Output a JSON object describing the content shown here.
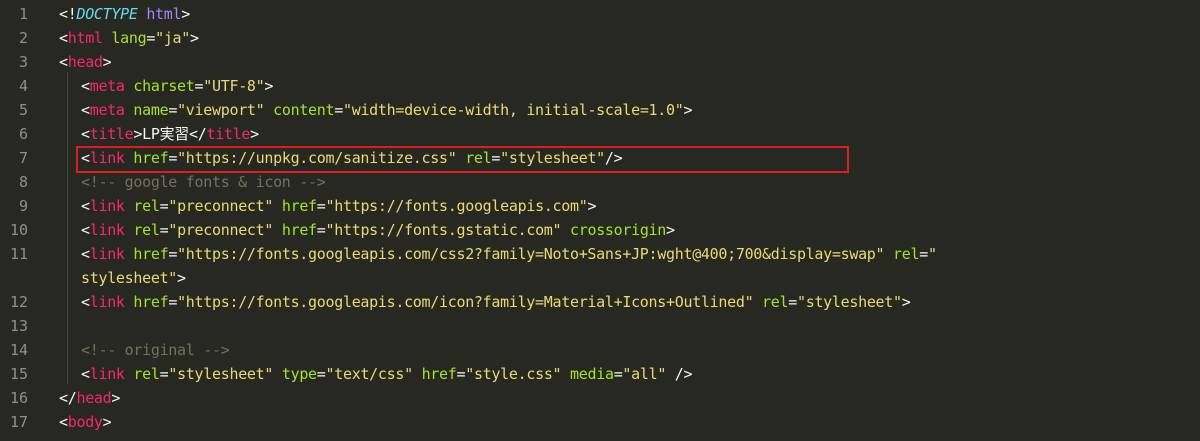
{
  "editor": {
    "theme": "dark",
    "colors": {
      "background": "#272822",
      "tag": "#f92672",
      "attribute": "#a6e22e",
      "string": "#e6db74",
      "comment": "#75715e",
      "line_number": "#90908a",
      "highlight_border": "#d9201f"
    },
    "lines": [
      {
        "n": "1",
        "indent": 0,
        "tokens": [
          {
            "t": "punct",
            "v": "<!"
          },
          {
            "t": "doc",
            "v": "DOCTYPE"
          },
          {
            "t": "punct",
            "v": " "
          },
          {
            "t": "doctype",
            "v": "html"
          },
          {
            "t": "punct",
            "v": ">"
          }
        ]
      },
      {
        "n": "2",
        "indent": 0,
        "tokens": [
          {
            "t": "punct",
            "v": "<"
          },
          {
            "t": "tag",
            "v": "html"
          },
          {
            "t": "punct",
            "v": " "
          },
          {
            "t": "attr",
            "v": "lang"
          },
          {
            "t": "punct",
            "v": "="
          },
          {
            "t": "str",
            "v": "\"ja\""
          },
          {
            "t": "punct",
            "v": ">"
          }
        ]
      },
      {
        "n": "3",
        "indent": 0,
        "tokens": [
          {
            "t": "punct",
            "v": "<"
          },
          {
            "t": "tag",
            "v": "head"
          },
          {
            "t": "punct",
            "v": ">"
          }
        ]
      },
      {
        "n": "4",
        "indent": 1,
        "tokens": [
          {
            "t": "punct",
            "v": "<"
          },
          {
            "t": "tag",
            "v": "meta"
          },
          {
            "t": "punct",
            "v": " "
          },
          {
            "t": "attr",
            "v": "charset"
          },
          {
            "t": "punct",
            "v": "="
          },
          {
            "t": "str",
            "v": "\"UTF-8\""
          },
          {
            "t": "punct",
            "v": ">"
          }
        ]
      },
      {
        "n": "5",
        "indent": 1,
        "tokens": [
          {
            "t": "punct",
            "v": "<"
          },
          {
            "t": "tag",
            "v": "meta"
          },
          {
            "t": "punct",
            "v": " "
          },
          {
            "t": "attr",
            "v": "name"
          },
          {
            "t": "punct",
            "v": "="
          },
          {
            "t": "str",
            "v": "\"viewport\""
          },
          {
            "t": "punct",
            "v": " "
          },
          {
            "t": "attr",
            "v": "content"
          },
          {
            "t": "punct",
            "v": "="
          },
          {
            "t": "str",
            "v": "\"width=device-width, initial-scale=1.0\""
          },
          {
            "t": "punct",
            "v": ">"
          }
        ]
      },
      {
        "n": "6",
        "indent": 1,
        "tokens": [
          {
            "t": "punct",
            "v": "<"
          },
          {
            "t": "tag",
            "v": "title"
          },
          {
            "t": "punct",
            "v": ">"
          },
          {
            "t": "text",
            "v": "LP実習"
          },
          {
            "t": "punct",
            "v": "</"
          },
          {
            "t": "tag",
            "v": "title"
          },
          {
            "t": "punct",
            "v": ">"
          }
        ]
      },
      {
        "n": "7",
        "indent": 1,
        "highlight": true,
        "tokens": [
          {
            "t": "punct",
            "v": "<"
          },
          {
            "t": "tag",
            "v": "link"
          },
          {
            "t": "punct",
            "v": " "
          },
          {
            "t": "attr",
            "v": "href"
          },
          {
            "t": "punct",
            "v": "="
          },
          {
            "t": "str",
            "v": "\"https://unpkg.com/sanitize.css\""
          },
          {
            "t": "punct",
            "v": " "
          },
          {
            "t": "attr",
            "v": "rel"
          },
          {
            "t": "punct",
            "v": "="
          },
          {
            "t": "str",
            "v": "\"stylesheet\""
          },
          {
            "t": "punct",
            "v": "/>"
          }
        ]
      },
      {
        "n": "8",
        "indent": 1,
        "tokens": [
          {
            "t": "comment",
            "v": "<!-- google fonts & icon -->"
          }
        ]
      },
      {
        "n": "9",
        "indent": 1,
        "tokens": [
          {
            "t": "punct",
            "v": "<"
          },
          {
            "t": "tag",
            "v": "link"
          },
          {
            "t": "punct",
            "v": " "
          },
          {
            "t": "attr",
            "v": "rel"
          },
          {
            "t": "punct",
            "v": "="
          },
          {
            "t": "str",
            "v": "\"preconnect\""
          },
          {
            "t": "punct",
            "v": " "
          },
          {
            "t": "attr",
            "v": "href"
          },
          {
            "t": "punct",
            "v": "="
          },
          {
            "t": "str",
            "v": "\"https://fonts.googleapis.com\""
          },
          {
            "t": "punct",
            "v": ">"
          }
        ]
      },
      {
        "n": "10",
        "indent": 1,
        "tokens": [
          {
            "t": "punct",
            "v": "<"
          },
          {
            "t": "tag",
            "v": "link"
          },
          {
            "t": "punct",
            "v": " "
          },
          {
            "t": "attr",
            "v": "rel"
          },
          {
            "t": "punct",
            "v": "="
          },
          {
            "t": "str",
            "v": "\"preconnect\""
          },
          {
            "t": "punct",
            "v": " "
          },
          {
            "t": "attr",
            "v": "href"
          },
          {
            "t": "punct",
            "v": "="
          },
          {
            "t": "str",
            "v": "\"https://fonts.gstatic.com\""
          },
          {
            "t": "punct",
            "v": " "
          },
          {
            "t": "attr",
            "v": "crossorigin"
          },
          {
            "t": "punct",
            "v": ">"
          }
        ]
      },
      {
        "n": "11",
        "indent": 1,
        "tokens": [
          {
            "t": "punct",
            "v": "<"
          },
          {
            "t": "tag",
            "v": "link"
          },
          {
            "t": "punct",
            "v": " "
          },
          {
            "t": "attr",
            "v": "href"
          },
          {
            "t": "punct",
            "v": "="
          },
          {
            "t": "str",
            "v": "\"https://fonts.googleapis.com/css2?family=Noto+Sans+JP:wght@400;700&display=swap\""
          },
          {
            "t": "punct",
            "v": " "
          },
          {
            "t": "attr",
            "v": "rel"
          },
          {
            "t": "punct",
            "v": "="
          },
          {
            "t": "str",
            "v": "\""
          }
        ]
      },
      {
        "n": "",
        "indent": 1,
        "tokens": [
          {
            "t": "str",
            "v": "stylesheet\""
          },
          {
            "t": "punct",
            "v": ">"
          }
        ]
      },
      {
        "n": "12",
        "indent": 1,
        "tokens": [
          {
            "t": "punct",
            "v": "<"
          },
          {
            "t": "tag",
            "v": "link"
          },
          {
            "t": "punct",
            "v": " "
          },
          {
            "t": "attr",
            "v": "href"
          },
          {
            "t": "punct",
            "v": "="
          },
          {
            "t": "str",
            "v": "\"https://fonts.googleapis.com/icon?family=Material+Icons+Outlined\""
          },
          {
            "t": "punct",
            "v": " "
          },
          {
            "t": "attr",
            "v": "rel"
          },
          {
            "t": "punct",
            "v": "="
          },
          {
            "t": "str",
            "v": "\"stylesheet\""
          },
          {
            "t": "punct",
            "v": ">"
          }
        ]
      },
      {
        "n": "13",
        "indent": 1,
        "tokens": []
      },
      {
        "n": "14",
        "indent": 1,
        "tokens": [
          {
            "t": "comment",
            "v": "<!-- original -->"
          }
        ]
      },
      {
        "n": "15",
        "indent": 1,
        "tokens": [
          {
            "t": "punct",
            "v": "<"
          },
          {
            "t": "tag",
            "v": "link"
          },
          {
            "t": "punct",
            "v": " "
          },
          {
            "t": "attr",
            "v": "rel"
          },
          {
            "t": "punct",
            "v": "="
          },
          {
            "t": "str",
            "v": "\"stylesheet\""
          },
          {
            "t": "punct",
            "v": " "
          },
          {
            "t": "attr",
            "v": "type"
          },
          {
            "t": "punct",
            "v": "="
          },
          {
            "t": "str",
            "v": "\"text/css\""
          },
          {
            "t": "punct",
            "v": " "
          },
          {
            "t": "attr",
            "v": "href"
          },
          {
            "t": "punct",
            "v": "="
          },
          {
            "t": "str",
            "v": "\"style.css\""
          },
          {
            "t": "punct",
            "v": " "
          },
          {
            "t": "attr",
            "v": "media"
          },
          {
            "t": "punct",
            "v": "="
          },
          {
            "t": "str",
            "v": "\"all\""
          },
          {
            "t": "punct",
            "v": " />"
          }
        ]
      },
      {
        "n": "16",
        "indent": 0,
        "tokens": [
          {
            "t": "punct",
            "v": "</"
          },
          {
            "t": "tag",
            "v": "head"
          },
          {
            "t": "punct",
            "v": ">"
          }
        ]
      },
      {
        "n": "17",
        "indent": 0,
        "tokens": [
          {
            "t": "punct",
            "v": "<"
          },
          {
            "t": "tag",
            "v": "body"
          },
          {
            "t": "punct",
            "v": ">"
          }
        ]
      }
    ]
  }
}
